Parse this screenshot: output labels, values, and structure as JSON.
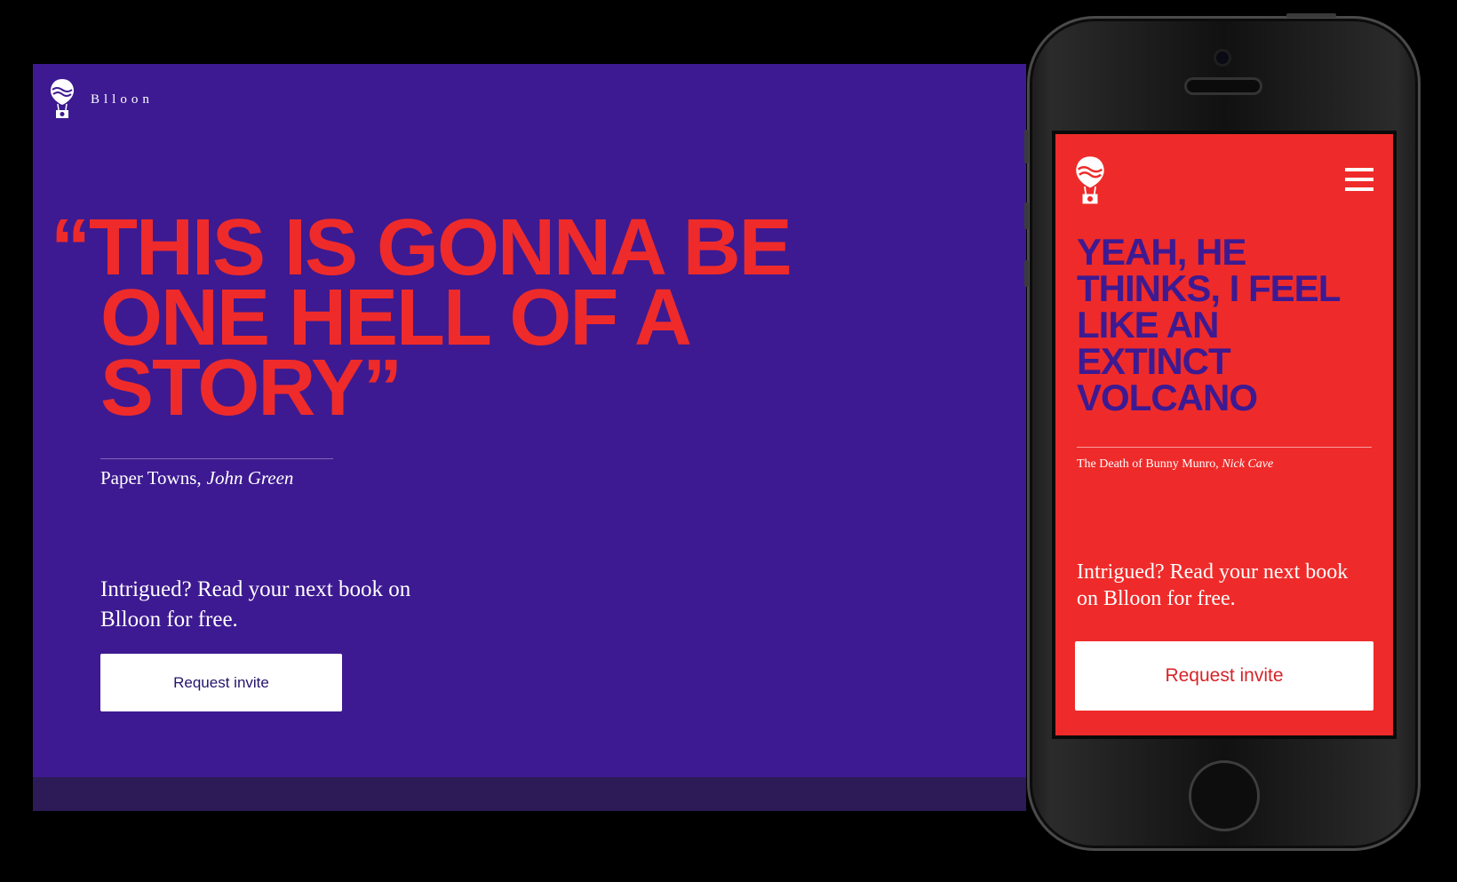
{
  "desktop": {
    "brand_name": "Blloon",
    "quote": "“This is gonna be one hell of a story”",
    "book_title": "Paper Towns,",
    "author": "John Green",
    "pitch": "Intrigued? Read your next book on Blloon for free.",
    "cta_label": "Request invite"
  },
  "mobile": {
    "quote": "Yeah, he thinks, I feel like an extinct volcano",
    "book_title": "The Death of Bunny Munro,",
    "author": "Nick Cave",
    "pitch": "Intrigued? Read your next book on Blloon for free.",
    "cta_label": "Request invite"
  },
  "icons": {
    "logo": "balloon-logo-icon",
    "menu": "hamburger-menu-icon"
  },
  "colors": {
    "purple": "#3d1a91",
    "red": "#ee2b2a",
    "footer_band": "#2c1b56",
    "white": "#ffffff"
  }
}
